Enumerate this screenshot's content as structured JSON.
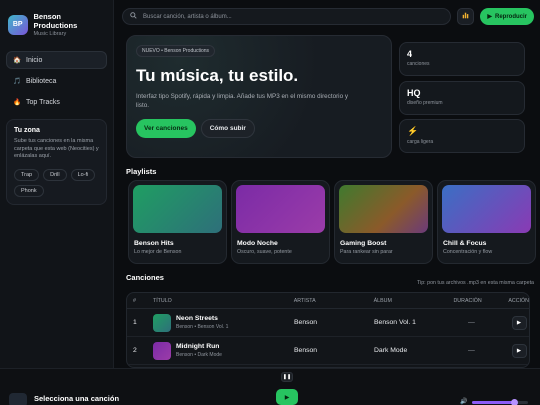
{
  "brand": {
    "initials": "BP",
    "name": "Benson Productions",
    "subtitle": "Music Library"
  },
  "nav": [
    {
      "icon": "🏠",
      "label": "Inicio"
    },
    {
      "icon": "🎵",
      "label": "Biblioteca"
    },
    {
      "icon": "🔥",
      "label": "Top Tracks"
    }
  ],
  "zone": {
    "title": "Tu zona",
    "text": "Sube tus canciones en la misma carpeta que esta web (Neocities) y enlázalas aquí.",
    "tags": [
      "Trap",
      "Drill",
      "Lo-fi",
      "Phonk"
    ]
  },
  "search": {
    "placeholder": "Buscar canción, artista o álbum..."
  },
  "topbar": {
    "play_label": "Reproducir"
  },
  "hero": {
    "badge": "NUEVO • Benson Productions",
    "title": "Tu música, tu estilo.",
    "subtitle": "Interfaz tipo Spotify, rápida y limpia. Añade tus MP3 en el mismo directorio y listo.",
    "primary": "Ver canciones",
    "secondary": "Cómo subir"
  },
  "stats": [
    {
      "value": "4",
      "label": "canciones"
    },
    {
      "value": "HQ",
      "label": "diseño premium"
    },
    {
      "value": "⚡",
      "label": "carga ligera"
    }
  ],
  "playlists_title": "Playlists",
  "playlists": [
    {
      "name": "Benson Hits",
      "desc": "Lo mejor de Benson"
    },
    {
      "name": "Modo Noche",
      "desc": "Oscuro, suave, potente"
    },
    {
      "name": "Gaming Boost",
      "desc": "Para rankear sin parar"
    },
    {
      "name": "Chill & Focus",
      "desc": "Concentración y flow"
    }
  ],
  "songs_title": "Canciones",
  "songs_hint": "Tip: pon tus archivos .mp3 en esta misma carpeta",
  "table": {
    "headers": [
      "#",
      "TÍTULO",
      "ARTISTA",
      "ÁLBUM",
      "DURACIÓN",
      "ACCIÓN"
    ],
    "rows": [
      {
        "num": "1",
        "title": "Neon Streets",
        "sub": "Benson • Benson Vol. 1",
        "artist": "Benson",
        "album": "Benson Vol. 1",
        "duration": "—"
      },
      {
        "num": "2",
        "title": "Midnight Run",
        "sub": "Benson • Dark Mode",
        "artist": "Benson",
        "album": "Dark Mode",
        "duration": "—"
      }
    ]
  },
  "player": {
    "now_playing": "Selecciona una canción",
    "volume": 0.75
  }
}
